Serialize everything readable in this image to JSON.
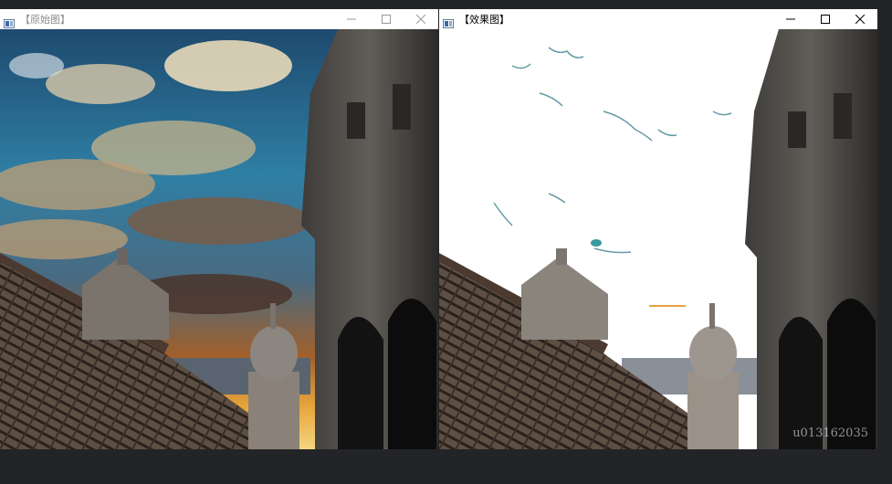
{
  "windows": {
    "left": {
      "title": "【原始图】"
    },
    "right": {
      "title": "【效果图】"
    }
  },
  "controls": {
    "minimize_icon": "minimize-icon",
    "maximize_icon": "maximize-icon",
    "close_icon": "close-icon"
  },
  "watermark": "u013162035"
}
